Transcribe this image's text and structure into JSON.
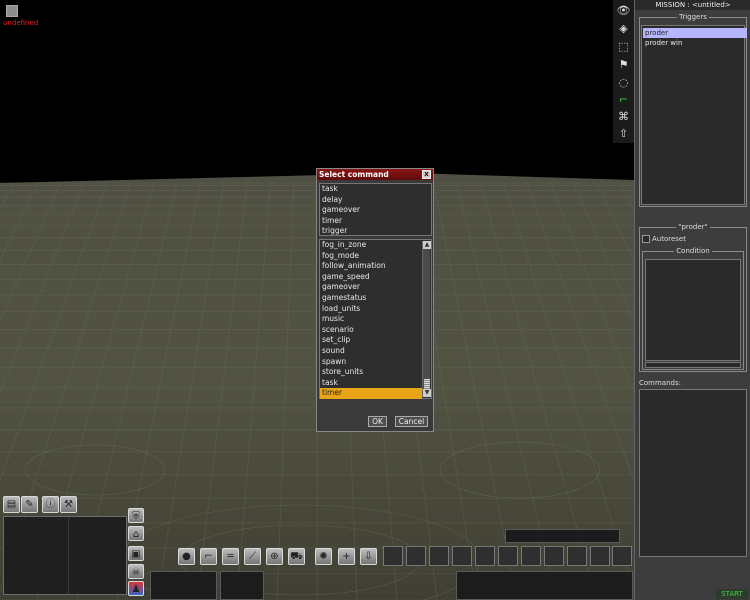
{
  "viewport": {
    "error_text": "undefined"
  },
  "dialog": {
    "title": "Select command",
    "close_glyph": "x",
    "top_items": [
      "task",
      "delay",
      "gameover",
      "timer",
      "trigger"
    ],
    "command_items": [
      "fog_in_zone",
      "fog_mode",
      "follow_animation",
      "game_speed",
      "gameover",
      "gamestatus",
      "load_units",
      "music",
      "scenario",
      "set_clip",
      "sound",
      "spawn",
      "store_units",
      "task",
      "timer"
    ],
    "selected_command": "timer",
    "ok_label": "OK",
    "cancel_label": "Cancel"
  },
  "panel": {
    "mission_title": "MISSION : <untitled>",
    "triggers_label": "Triggers",
    "triggers": [
      {
        "label": "proder",
        "selected": true
      },
      {
        "label": "proder win",
        "selected": false
      }
    ],
    "selected_trigger_label": "\"proder\"",
    "autoreset_label": "Autoreset",
    "autoreset_checked": false,
    "condition_label": "Condition",
    "commands_label": "Commands:",
    "start_label": "START"
  },
  "tool_icons": [
    "eye-icon",
    "tag-icon",
    "selection-icon",
    "flag-icon",
    "circle-icon",
    "path-icon",
    "camera-icon",
    "arrow-up-icon"
  ],
  "colors": {
    "selection_highlight": "#e8a517",
    "trigger_highlight": "#b6b6ff",
    "dialog_title_bar": "#7a1010",
    "error_text": "#e02020",
    "start_text": "#3fd23f"
  }
}
